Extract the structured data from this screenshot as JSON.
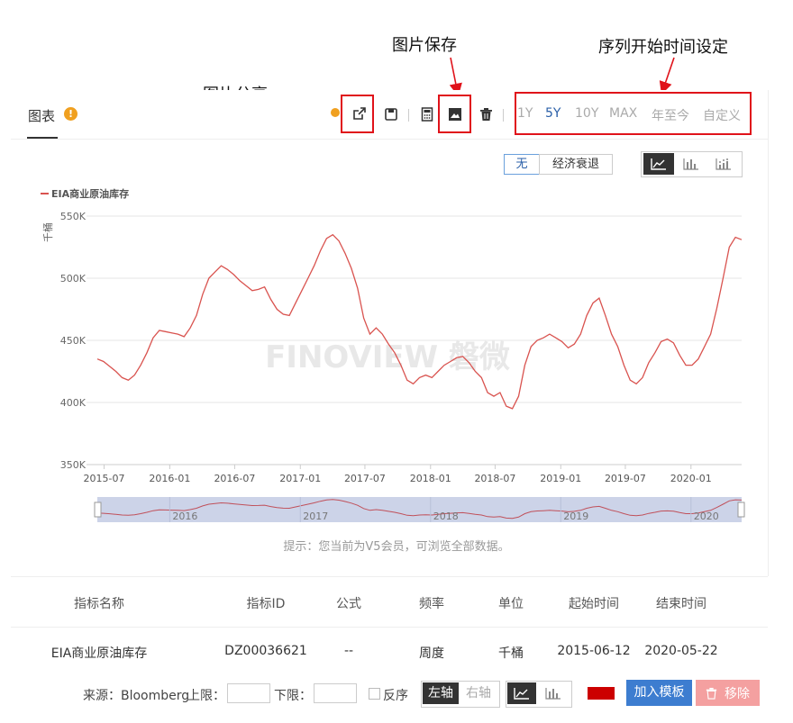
{
  "annotations": {
    "share": "图片分享",
    "save": "图片保存",
    "series_start": "序列开始时间设定"
  },
  "tab": {
    "label": "图表"
  },
  "toolbar": {
    "ranges": [
      "1Y",
      "5Y",
      "10Y",
      "MAX",
      "年至今",
      "自定义"
    ],
    "active_range": "5Y"
  },
  "recession": {
    "none_label": "无",
    "recession_label": "经济衰退"
  },
  "chart_data": {
    "type": "line",
    "series": [
      {
        "name": "EIA商业原油库存",
        "color": "#d9534f"
      }
    ],
    "ylabel": "千桶",
    "yticks": [
      "550K",
      "500K",
      "450K",
      "400K",
      "350K"
    ],
    "ytick_values": [
      550,
      500,
      450,
      400,
      350
    ],
    "ylim": [
      350,
      550
    ],
    "xticks": [
      "2015-07",
      "2016-01",
      "2016-07",
      "2017-01",
      "2017-07",
      "2018-01",
      "2018-07",
      "2019-01",
      "2019-07",
      "2020-01"
    ],
    "xlim": [
      "2015-06-12",
      "2020-05-22"
    ],
    "values_K": [
      435,
      433,
      429,
      425,
      420,
      418,
      422,
      430,
      440,
      452,
      458,
      457,
      456,
      455,
      453,
      460,
      470,
      487,
      500,
      505,
      510,
      507,
      503,
      498,
      494,
      490,
      491,
      493,
      483,
      475,
      471,
      470,
      480,
      490,
      500,
      510,
      522,
      532,
      535,
      530,
      520,
      508,
      492,
      468,
      455,
      460,
      455,
      447,
      440,
      430,
      418,
      415,
      420,
      422,
      420,
      425,
      430,
      433,
      436,
      437,
      432,
      425,
      420,
      408,
      405,
      408,
      397,
      395,
      405,
      430,
      445,
      450,
      452,
      455,
      452,
      449,
      444,
      447,
      455,
      470,
      480,
      484,
      470,
      455,
      445,
      430,
      418,
      415,
      420,
      432,
      440,
      449,
      451,
      448,
      438,
      430,
      430,
      435,
      445,
      455,
      476,
      500,
      525,
      533,
      531
    ],
    "navigator_years": [
      "2016",
      "2017",
      "2018",
      "2019",
      "2020"
    ],
    "watermark": "FINOVIEW 磐微",
    "hint": "提示：您当前为V5会员，可浏览全部数据。"
  },
  "table": {
    "headers": [
      "指标名称",
      "指标ID",
      "公式",
      "频率",
      "单位",
      "起始时间",
      "结束时间"
    ],
    "row": [
      "EIA商业原油库存",
      "DZ00036621",
      "--",
      "周度",
      "千桶",
      "2015-06-12",
      "2020-05-22"
    ]
  },
  "controls": {
    "source": "来源：Bloomberg",
    "upper": "上限：",
    "lower": "下限：",
    "reverse": "反序",
    "left_axis": "左轴",
    "right_axis": "右轴",
    "series_color": "#cc0000",
    "add_template": "加入模板",
    "remove": "移除"
  },
  "colors": {
    "accent": "#2a5fa8",
    "line": "#d9534f",
    "annotation_red": "#e0121a",
    "add_button": "#3d7dd0",
    "remove_button": "#f4a0a0"
  }
}
